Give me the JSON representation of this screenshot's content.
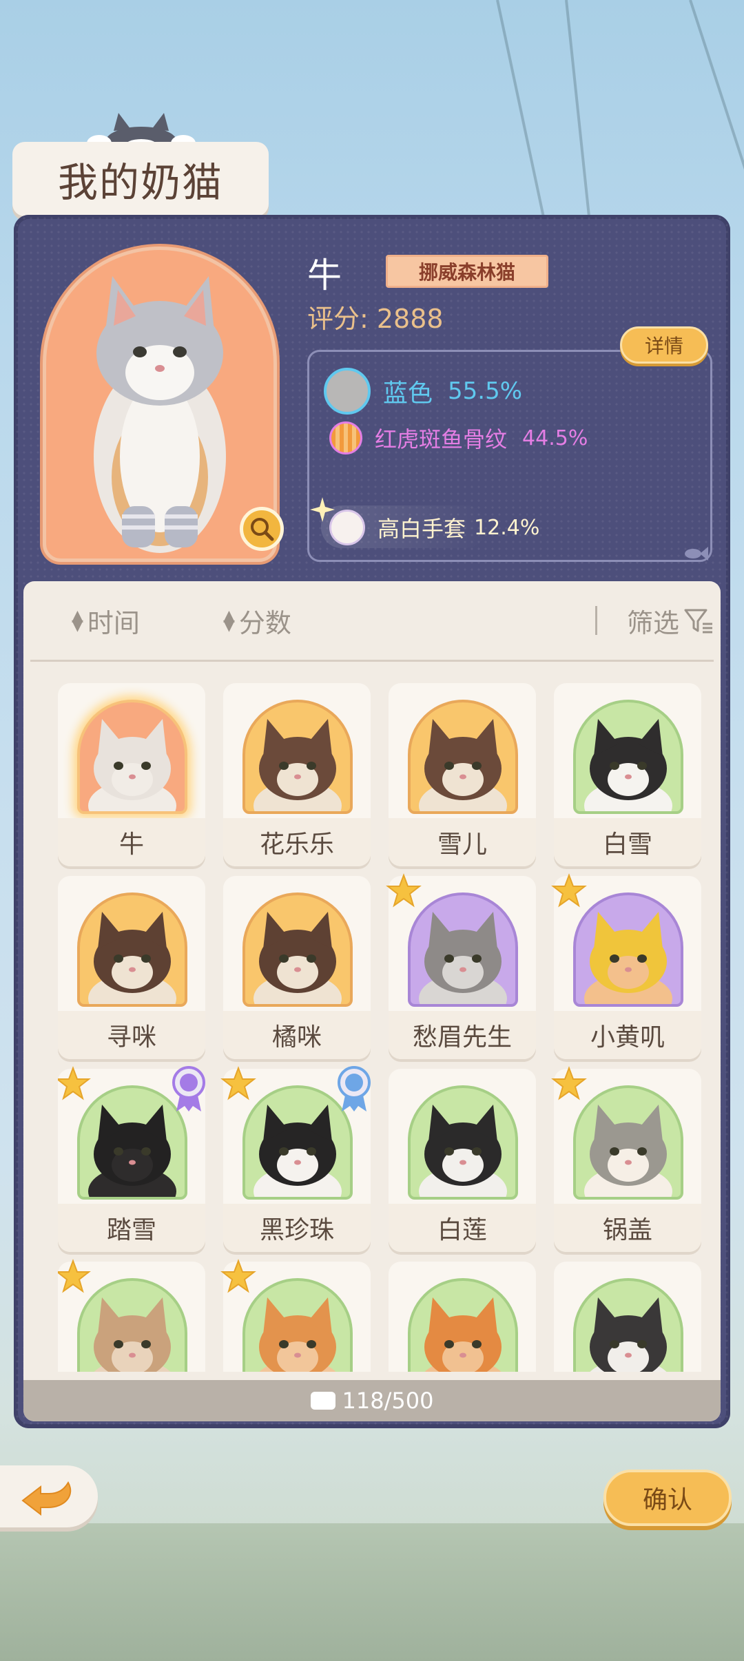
{
  "title": "我的奶猫",
  "selected_cat": {
    "name": "牛",
    "breed": "挪威森林猫",
    "score_label": "评分: 2888",
    "detail_label": "详情",
    "genes": [
      {
        "label": "蓝色",
        "percent": "55.5%",
        "color": "#60c9ef",
        "swatch": "#b8b7b6"
      },
      {
        "label": "红虎斑鱼骨纹",
        "percent": "44.5%",
        "color": "#e47ee4",
        "swatch": "#f29a3c"
      },
      {
        "label": "高白手套",
        "percent": "12.4%",
        "color": "#fff3cf",
        "swatch": "#f7f1ee"
      }
    ]
  },
  "sort": {
    "time_label": "时间",
    "score_label": "分数",
    "filter_label": "筛选"
  },
  "cats": [
    {
      "name": "牛",
      "bg": "#f8a97f",
      "border": "#f7c27a",
      "fur": "#e8e2dc",
      "face": "#f1ece6",
      "star": false,
      "medal": "",
      "selected": true
    },
    {
      "name": "花乐乐",
      "bg": "#f9c66c",
      "border": "#e9a85a",
      "fur": "#6b4a3a",
      "face": "#efe3d2",
      "star": false,
      "medal": ""
    },
    {
      "name": "雪儿",
      "bg": "#f9c66c",
      "border": "#e9a85a",
      "fur": "#6b4a3a",
      "face": "#efe3d2",
      "star": false,
      "medal": ""
    },
    {
      "name": "白雪",
      "bg": "#c8e6a5",
      "border": "#a6cf86",
      "fur": "#2f2d2d",
      "face": "#f5f3ef",
      "star": false,
      "medal": ""
    },
    {
      "name": "寻咪",
      "bg": "#f9c66c",
      "border": "#e9a85a",
      "fur": "#5e4133",
      "face": "#efe3d2",
      "star": false,
      "medal": ""
    },
    {
      "name": "橘咪",
      "bg": "#f9c66c",
      "border": "#e9a85a",
      "fur": "#5e4133",
      "face": "#efe3d2",
      "star": false,
      "medal": ""
    },
    {
      "name": "愁眉先生",
      "bg": "#c8a9ea",
      "border": "#a886d6",
      "fur": "#8e8a88",
      "face": "#d9d6d3",
      "star": true,
      "medal": ""
    },
    {
      "name": "小黄叽",
      "bg": "#c8a9ea",
      "border": "#a886d6",
      "fur": "#f0c53b",
      "face": "#f3c08c",
      "star": true,
      "medal": ""
    },
    {
      "name": "踏雪",
      "bg": "#c8e6a5",
      "border": "#a6cf86",
      "fur": "#232222",
      "face": "#2e2c2c",
      "star": true,
      "medal": "purple"
    },
    {
      "name": "黑珍珠",
      "bg": "#c8e6a5",
      "border": "#a6cf86",
      "fur": "#262525",
      "face": "#f5f2ee",
      "star": true,
      "medal": "blue"
    },
    {
      "name": "白莲",
      "bg": "#c8e6a5",
      "border": "#a6cf86",
      "fur": "#2b2a2a",
      "face": "#f2f0ec",
      "star": false,
      "medal": ""
    },
    {
      "name": "锅盖",
      "bg": "#c8e6a5",
      "border": "#a6cf86",
      "fur": "#9b9890",
      "face": "#f6efe6",
      "star": true,
      "medal": ""
    },
    {
      "name": "",
      "bg": "#c8e6a5",
      "border": "#a6cf86",
      "fur": "#caa27c",
      "face": "#e9d3bb",
      "star": true,
      "medal": ""
    },
    {
      "name": "",
      "bg": "#c8e6a5",
      "border": "#a6cf86",
      "fur": "#e3934d",
      "face": "#f2c69a",
      "star": true,
      "medal": ""
    },
    {
      "name": "",
      "bg": "#c8e6a5",
      "border": "#a6cf86",
      "fur": "#e48a42",
      "face": "#f1c191",
      "star": false,
      "medal": ""
    },
    {
      "name": "",
      "bg": "#c8e6a5",
      "border": "#a6cf86",
      "fur": "#3a3838",
      "face": "#f1eeea",
      "star": false,
      "medal": ""
    }
  ],
  "capacity": "118/500",
  "confirm_label": "确认"
}
